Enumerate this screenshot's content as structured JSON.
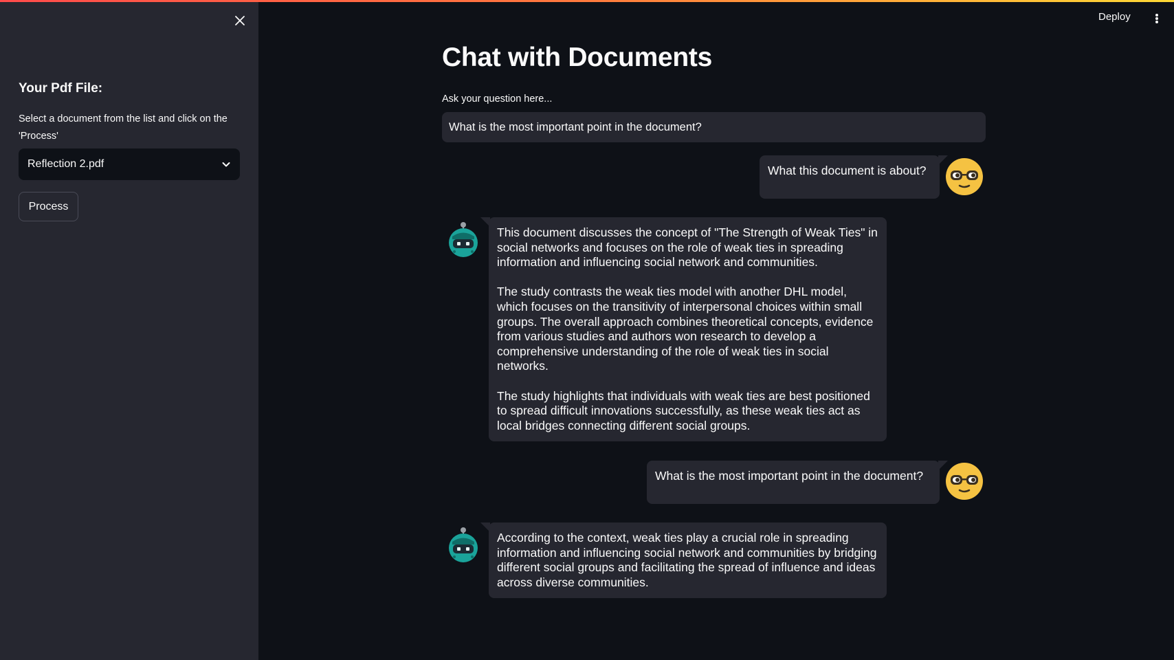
{
  "sidebar": {
    "heading": "Your Pdf File:",
    "description": "Select a document from the list and click on the 'Process'",
    "select": {
      "value": "Reflection 2.pdf"
    },
    "process_label": "Process"
  },
  "header": {
    "deploy_label": "Deploy"
  },
  "main": {
    "title": "Chat with Documents",
    "input_label": "Ask your question here...",
    "input_value": "What is the most important point in the document?"
  },
  "messages": [
    {
      "role": "user",
      "paragraphs": [
        "What this document is about?"
      ]
    },
    {
      "role": "bot",
      "paragraphs": [
        "This document discusses the concept of \"The Strength of Weak Ties\" in social networks and focuses on the role of weak ties in spreading information and influencing social network and communities.",
        "The study contrasts the weak ties model with another DHL model, which focuses on the transitivity of interpersonal choices within small groups. The overall approach combines theoretical concepts, evidence from various studies and authors won research to develop a comprehensive understanding of the role of weak ties in social networks.",
        "The study highlights that individuals with weak ties are best positioned to spread difficult innovations successfully, as these weak ties act as local bridges connecting different social groups."
      ]
    },
    {
      "role": "user",
      "paragraphs": [
        "What is the most important point in the document?"
      ]
    },
    {
      "role": "bot",
      "paragraphs": [
        "According to the context, weak ties play a crucial role in spreading information and influencing social network and communities by bridging different social groups and facilitating the spread of influence and ideas across diverse communities."
      ]
    }
  ],
  "colors": {
    "background": "#0e1117",
    "sidebar": "#262730",
    "bubble": "#262730",
    "user_avatar": "#f5c242",
    "bot_avatar": "#1aa39a"
  }
}
